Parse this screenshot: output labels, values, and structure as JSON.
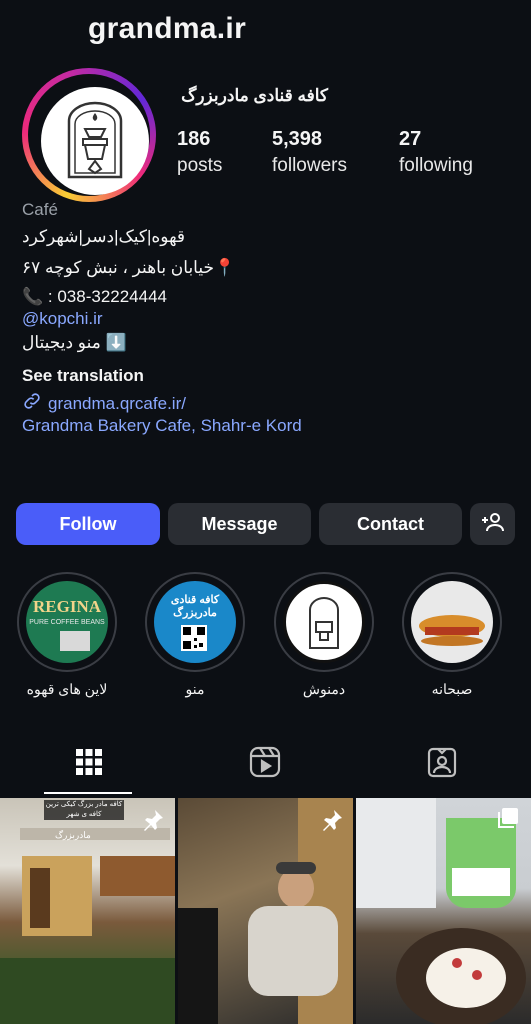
{
  "profile": {
    "username": "grandma.ir",
    "display_name": "کافه قنادی مادربزرگ",
    "stats": {
      "posts": {
        "value": "186",
        "label": "posts"
      },
      "followers": {
        "value": "5,398",
        "label": "followers"
      },
      "following": {
        "value": "27",
        "label": "following"
      }
    }
  },
  "bio": {
    "category": "Café",
    "line1": "قهوه|کیک|دسر|شهرکرد",
    "line2": "📍خیابان باهنر ، نبش کوچه ۶۷",
    "line3": "📞 : 038-32224444",
    "mention": "@kopchi.ir",
    "line5": "⬇️ منو دیجیتال",
    "see_translation": "See translation",
    "link": "grandma.qrcafe.ir/",
    "location": "Grandma Bakery Cafe, Shahr-e Kord"
  },
  "actions": {
    "follow": "Follow",
    "message": "Message",
    "contact": "Contact"
  },
  "highlights": [
    {
      "label": "لاین های قهوه",
      "icon": "regina-coffee-thumbnail"
    },
    {
      "label": "منو",
      "icon": "menu-qr-thumbnail"
    },
    {
      "label": "دمنوش",
      "icon": "cafe-logo-thumbnail"
    },
    {
      "label": "صبحانه",
      "icon": "breakfast-croissant-thumbnail"
    }
  ],
  "highlight_text": {
    "regina_brand": "REGINA",
    "regina_sub": "PURE COFFEE BEANS",
    "menu_title": "کافه قنادی مادربزرگ"
  },
  "tabs": [
    "grid-icon",
    "reels-icon",
    "tagged-icon"
  ],
  "posts": [
    {
      "overlay": "کافه مادر بزرگ کیکی ترین کافه ی شهر",
      "sign": "مادربزرگ",
      "pinned": true
    },
    {
      "pinned": true
    },
    {
      "pinned": false
    }
  ],
  "colors": {
    "background": "#0c0f14",
    "follow_button": "#4a5df9",
    "secondary_button": "#2a2d33",
    "link": "#8aa8ff"
  }
}
